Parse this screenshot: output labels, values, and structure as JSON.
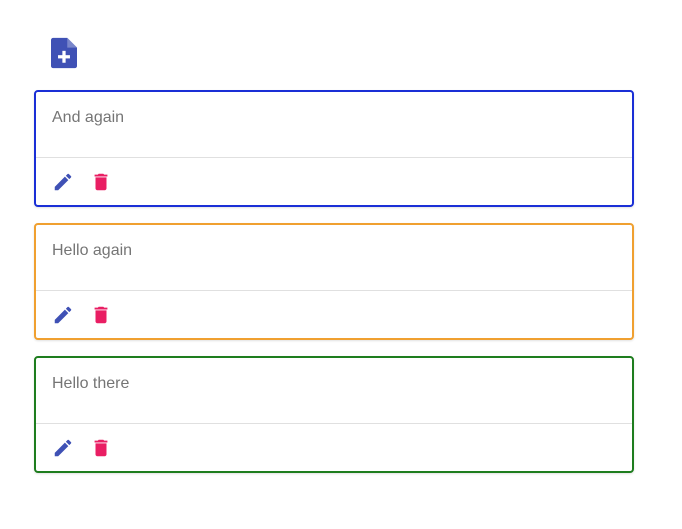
{
  "toolbar": {
    "new_note_icon": "note-add-icon",
    "icon_color": "#3f51b5"
  },
  "notes": [
    {
      "text": "And again",
      "border_color": "#1a2fd6"
    },
    {
      "text": "Hello again",
      "border_color": "#f0a030"
    },
    {
      "text": "Hello there",
      "border_color": "#1e7d1e"
    }
  ],
  "actions": {
    "edit_icon": "pencil-icon",
    "edit_color": "#3f51b5",
    "delete_icon": "trash-icon",
    "delete_color": "#e91e63"
  }
}
